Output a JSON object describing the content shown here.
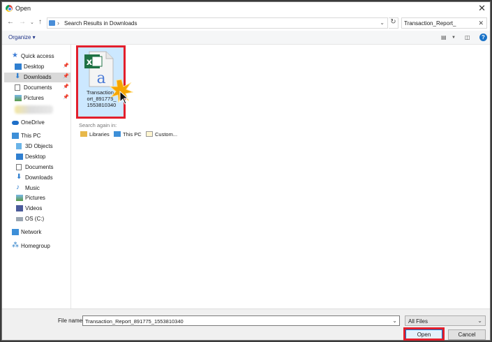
{
  "window": {
    "title": "Open"
  },
  "nav": {
    "path": "Search Results in Downloads",
    "search_value": "Transaction_Report_"
  },
  "toolbar": {
    "organize_label": "Organize ▾"
  },
  "sidebar": {
    "quick_access": "Quick access",
    "desktop": "Desktop",
    "downloads": "Downloads",
    "documents": "Documents",
    "pictures": "Pictures",
    "onedrive": "OneDrive",
    "this_pc": "This PC",
    "objects_3d": "3D Objects",
    "pc_desktop": "Desktop",
    "pc_documents": "Documents",
    "pc_downloads": "Downloads",
    "music": "Music",
    "pc_pictures": "Pictures",
    "videos": "Videos",
    "os_c": "OS (C:)",
    "network": "Network",
    "homegroup": "Homegroup"
  },
  "content": {
    "file": {
      "line1": "Transaction_",
      "line2": "ort_891775_",
      "line3": "1553810340"
    },
    "search_again_label": "Search again in:",
    "search_options": [
      "Libraries",
      "This PC",
      "Custom..."
    ]
  },
  "footer": {
    "file_name_label": "File name:",
    "file_name_value": "Transaction_Report_891775_1553810340",
    "filter_value": "All Files",
    "open_label": "Open",
    "cancel_label": "Cancel"
  },
  "colors": {
    "accent": "#0078d7",
    "highlight": "#e21f2c",
    "selection": "#cce8ff"
  }
}
